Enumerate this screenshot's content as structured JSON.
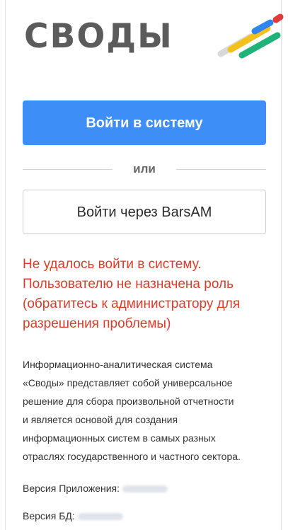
{
  "logo": {
    "text": "СВОДЫ",
    "stripe_colors": [
      "#e23b3b",
      "#f3c11c",
      "#2f86f2",
      "#1fb37a",
      "#d9d9d9"
    ]
  },
  "login": {
    "primary_button_label": "Войти в систему",
    "divider_text": "или",
    "secondary_button_label": "Войти через BarsAM"
  },
  "error": {
    "lines": [
      "Не удалось войти в систему.",
      "Пользователю не назначена роль",
      "(обратитесь к администратору для",
      "разрешения проблемы)"
    ]
  },
  "description": {
    "lines": [
      "Информационно-аналитическая система",
      "«Своды» представляет собой универсальное",
      "решение для сбора произвольной отчетности",
      "и является основой для создания",
      "информационных систем в самых разных",
      "отраслях государственного и частного сектора."
    ]
  },
  "versions": {
    "app_label": "Версия Приложения:",
    "db_label": "Версия БД:"
  },
  "colors": {
    "primary": "#3e8ef7",
    "error": "#e03b2a"
  }
}
